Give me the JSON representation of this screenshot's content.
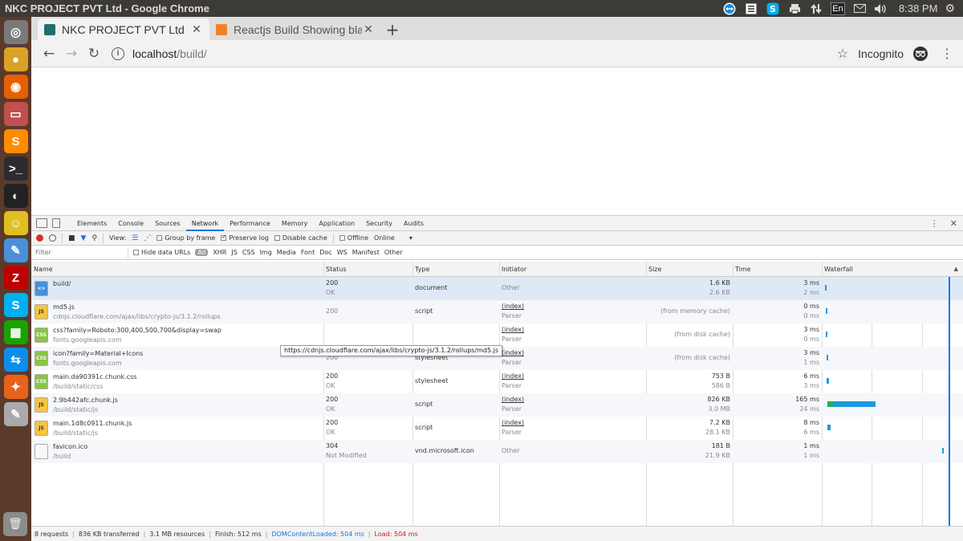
{
  "window_title": "NKC PROJECT PVT Ltd - Google Chrome",
  "tray": {
    "keyboard": "En",
    "clock": "8:38 PM",
    "icons": [
      "teamviewer-icon",
      "list-icon",
      "skype-icon",
      "printer-icon",
      "network-icon",
      "keyboard-layout-icon",
      "mail-icon",
      "volume-icon",
      "gear-icon"
    ]
  },
  "launcher": [
    {
      "name": "ubuntu-dash-icon",
      "glyph": "◎",
      "color": "#7a7a7a"
    },
    {
      "name": "chrome-icon",
      "glyph": "●",
      "color": "#d8a326"
    },
    {
      "name": "firefox-icon",
      "glyph": "◉",
      "color": "#e66000"
    },
    {
      "name": "files-icon",
      "glyph": "▭",
      "color": "#c0504d"
    },
    {
      "name": "sublime-text-icon",
      "glyph": "S",
      "color": "#ff8c00"
    },
    {
      "name": "terminal-icon",
      "glyph": ">_",
      "color": "#2c2c2c"
    },
    {
      "name": "kazam-icon",
      "glyph": "◐",
      "color": "#222222"
    },
    {
      "name": "emoji-icon",
      "glyph": "☺",
      "color": "#e0c020"
    },
    {
      "name": "text-editor-icon",
      "glyph": "✎",
      "color": "#4a90d9"
    },
    {
      "name": "filezilla-icon",
      "glyph": "Z",
      "color": "#bf0000"
    },
    {
      "name": "skype-icon",
      "glyph": "S",
      "color": "#00aff0"
    },
    {
      "name": "calc-icon",
      "glyph": "▦",
      "color": "#18a303"
    },
    {
      "name": "teamviewer-icon",
      "glyph": "⇆",
      "color": "#0e8ee9"
    },
    {
      "name": "compass-icon",
      "glyph": "✦",
      "color": "#e8631a"
    },
    {
      "name": "notes-icon",
      "glyph": "✎",
      "color": "#aaaaaa"
    }
  ],
  "tabs": [
    {
      "title": "NKC PROJECT PVT Ltd",
      "active": true,
      "fav_color": "#1f6f6f"
    },
    {
      "title": "Reactjs Build Showing bla",
      "active": false,
      "fav_color": "#f48024"
    }
  ],
  "omnibox": {
    "host": "localhost",
    "path": "/build/"
  },
  "profile_label": "Incognito",
  "devtools": {
    "tabs": [
      "Elements",
      "Console",
      "Sources",
      "Network",
      "Performance",
      "Memory",
      "Application",
      "Security",
      "Audits"
    ],
    "active_tab": "Network",
    "toolbar": {
      "view_label": "View:",
      "group_by_frame": "Group by frame",
      "preserve_log": "Preserve log",
      "disable_cache": "Disable cache",
      "offline": "Offline",
      "throttle": "Online"
    },
    "filter": {
      "placeholder": "Filter",
      "hide_data_urls": "Hide data URLs",
      "types": [
        "All",
        "XHR",
        "JS",
        "CSS",
        "Img",
        "Media",
        "Font",
        "Doc",
        "WS",
        "Manifest",
        "Other"
      ]
    },
    "columns": [
      "Name",
      "Status",
      "Type",
      "Initiator",
      "Size",
      "Time",
      "Waterfall"
    ],
    "rows": [
      {
        "icon": "<>",
        "name": "build/",
        "path": "",
        "status": "200",
        "status_text": "OK",
        "type": "document",
        "initiator": "Other",
        "initiator_sub": "",
        "size": "1.6 KB",
        "size_sub": "2.6 KB",
        "time": "3 ms",
        "time_sub": "2 ms"
      },
      {
        "icon": "JS",
        "name": "md5.js",
        "path": "cdnjs.cloudflare.com/ajax/libs/crypto-js/3.1.2/rollups",
        "status": "200",
        "status_text": "",
        "type": "script",
        "initiator": "(index)",
        "initiator_sub": "Parser",
        "size": "(from memory cache)",
        "size_sub": "",
        "time": "0 ms",
        "time_sub": "0 ms"
      },
      {
        "icon": "CSS",
        "name": "css?family=Roboto:300,400,500,700&display=swap",
        "path": "fonts.googleapis.com",
        "status": "",
        "status_text": "",
        "type": "",
        "initiator": "(index)",
        "initiator_sub": "Parser",
        "size": "(from disk cache)",
        "size_sub": "",
        "time": "3 ms",
        "time_sub": "0 ms"
      },
      {
        "icon": "CSS",
        "name": "icon?family=Material+Icons",
        "path": "fonts.googleapis.com",
        "status": "200",
        "status_text": "",
        "type": "stylesheet",
        "initiator": "(index)",
        "initiator_sub": "Parser",
        "size": "(from disk cache)",
        "size_sub": "",
        "time": "3 ms",
        "time_sub": "1 ms"
      },
      {
        "icon": "CSS",
        "name": "main.da90391c.chunk.css",
        "path": "/build/static/css",
        "status": "200",
        "status_text": "OK",
        "type": "stylesheet",
        "initiator": "(index)",
        "initiator_sub": "Parser",
        "size": "753 B",
        "size_sub": "586 B",
        "time": "6 ms",
        "time_sub": "3 ms"
      },
      {
        "icon": "JS",
        "name": "2.9b442afc.chunk.js",
        "path": "/build/static/js",
        "status": "200",
        "status_text": "OK",
        "type": "script",
        "initiator": "(index)",
        "initiator_sub": "Parser",
        "size": "826 KB",
        "size_sub": "3.0 MB",
        "time": "165 ms",
        "time_sub": "24 ms"
      },
      {
        "icon": "JS",
        "name": "main.1d8c0911.chunk.js",
        "path": "/build/static/js",
        "status": "200",
        "status_text": "OK",
        "type": "script",
        "initiator": "(index)",
        "initiator_sub": "Parser",
        "size": "7.2 KB",
        "size_sub": "28.1 KB",
        "time": "8 ms",
        "time_sub": "6 ms"
      },
      {
        "icon": "",
        "name": "favicon.ico",
        "path": "/build",
        "status": "304",
        "status_text": "Not Modified",
        "type": "vnd.microsoft.icon",
        "initiator": "Other",
        "initiator_sub": "",
        "size": "181 B",
        "size_sub": "21.9 KB",
        "time": "1 ms",
        "time_sub": "1 ms"
      }
    ],
    "tooltip": "https://cdnjs.cloudflare.com/ajax/libs/crypto-js/3.1.2/rollups/md5.js",
    "status_bar": {
      "requests": "8 requests",
      "transferred": "836 KB transferred",
      "resources": "3.1 MB resources",
      "finish": "Finish: 512 ms",
      "dom_loaded": "DOMContentLoaded: 504 ms",
      "load": "Load: 504 ms"
    },
    "colors": {
      "dom_loaded": "#1a73e8",
      "load": "#c5221f",
      "waterfall_bar": "#1a9be0",
      "waterfall_wait": "#34a853"
    }
  }
}
